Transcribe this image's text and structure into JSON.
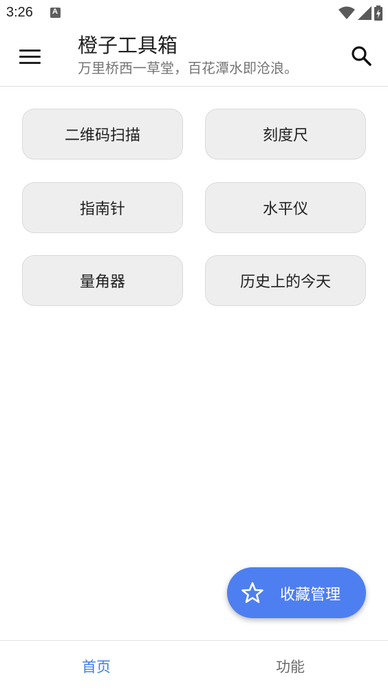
{
  "status_bar": {
    "time": "3:26",
    "notification_icon": "A"
  },
  "app_bar": {
    "title": "橙子工具箱",
    "subtitle": "万里桥西一草堂，百花潭水即沧浪。"
  },
  "tools": [
    {
      "label": "二维码扫描"
    },
    {
      "label": "刻度尺"
    },
    {
      "label": "指南针"
    },
    {
      "label": "水平仪"
    },
    {
      "label": "量角器"
    },
    {
      "label": "历史上的今天"
    }
  ],
  "fab": {
    "label": "收藏管理",
    "icon": "star-outline-icon"
  },
  "bottom_nav": {
    "items": [
      {
        "label": "首页",
        "active": true
      },
      {
        "label": "功能",
        "active": false
      }
    ]
  },
  "colors": {
    "accent": "#4e7ff0",
    "nav_active": "#3f7ee8",
    "tool_bg": "#eeeeee"
  }
}
